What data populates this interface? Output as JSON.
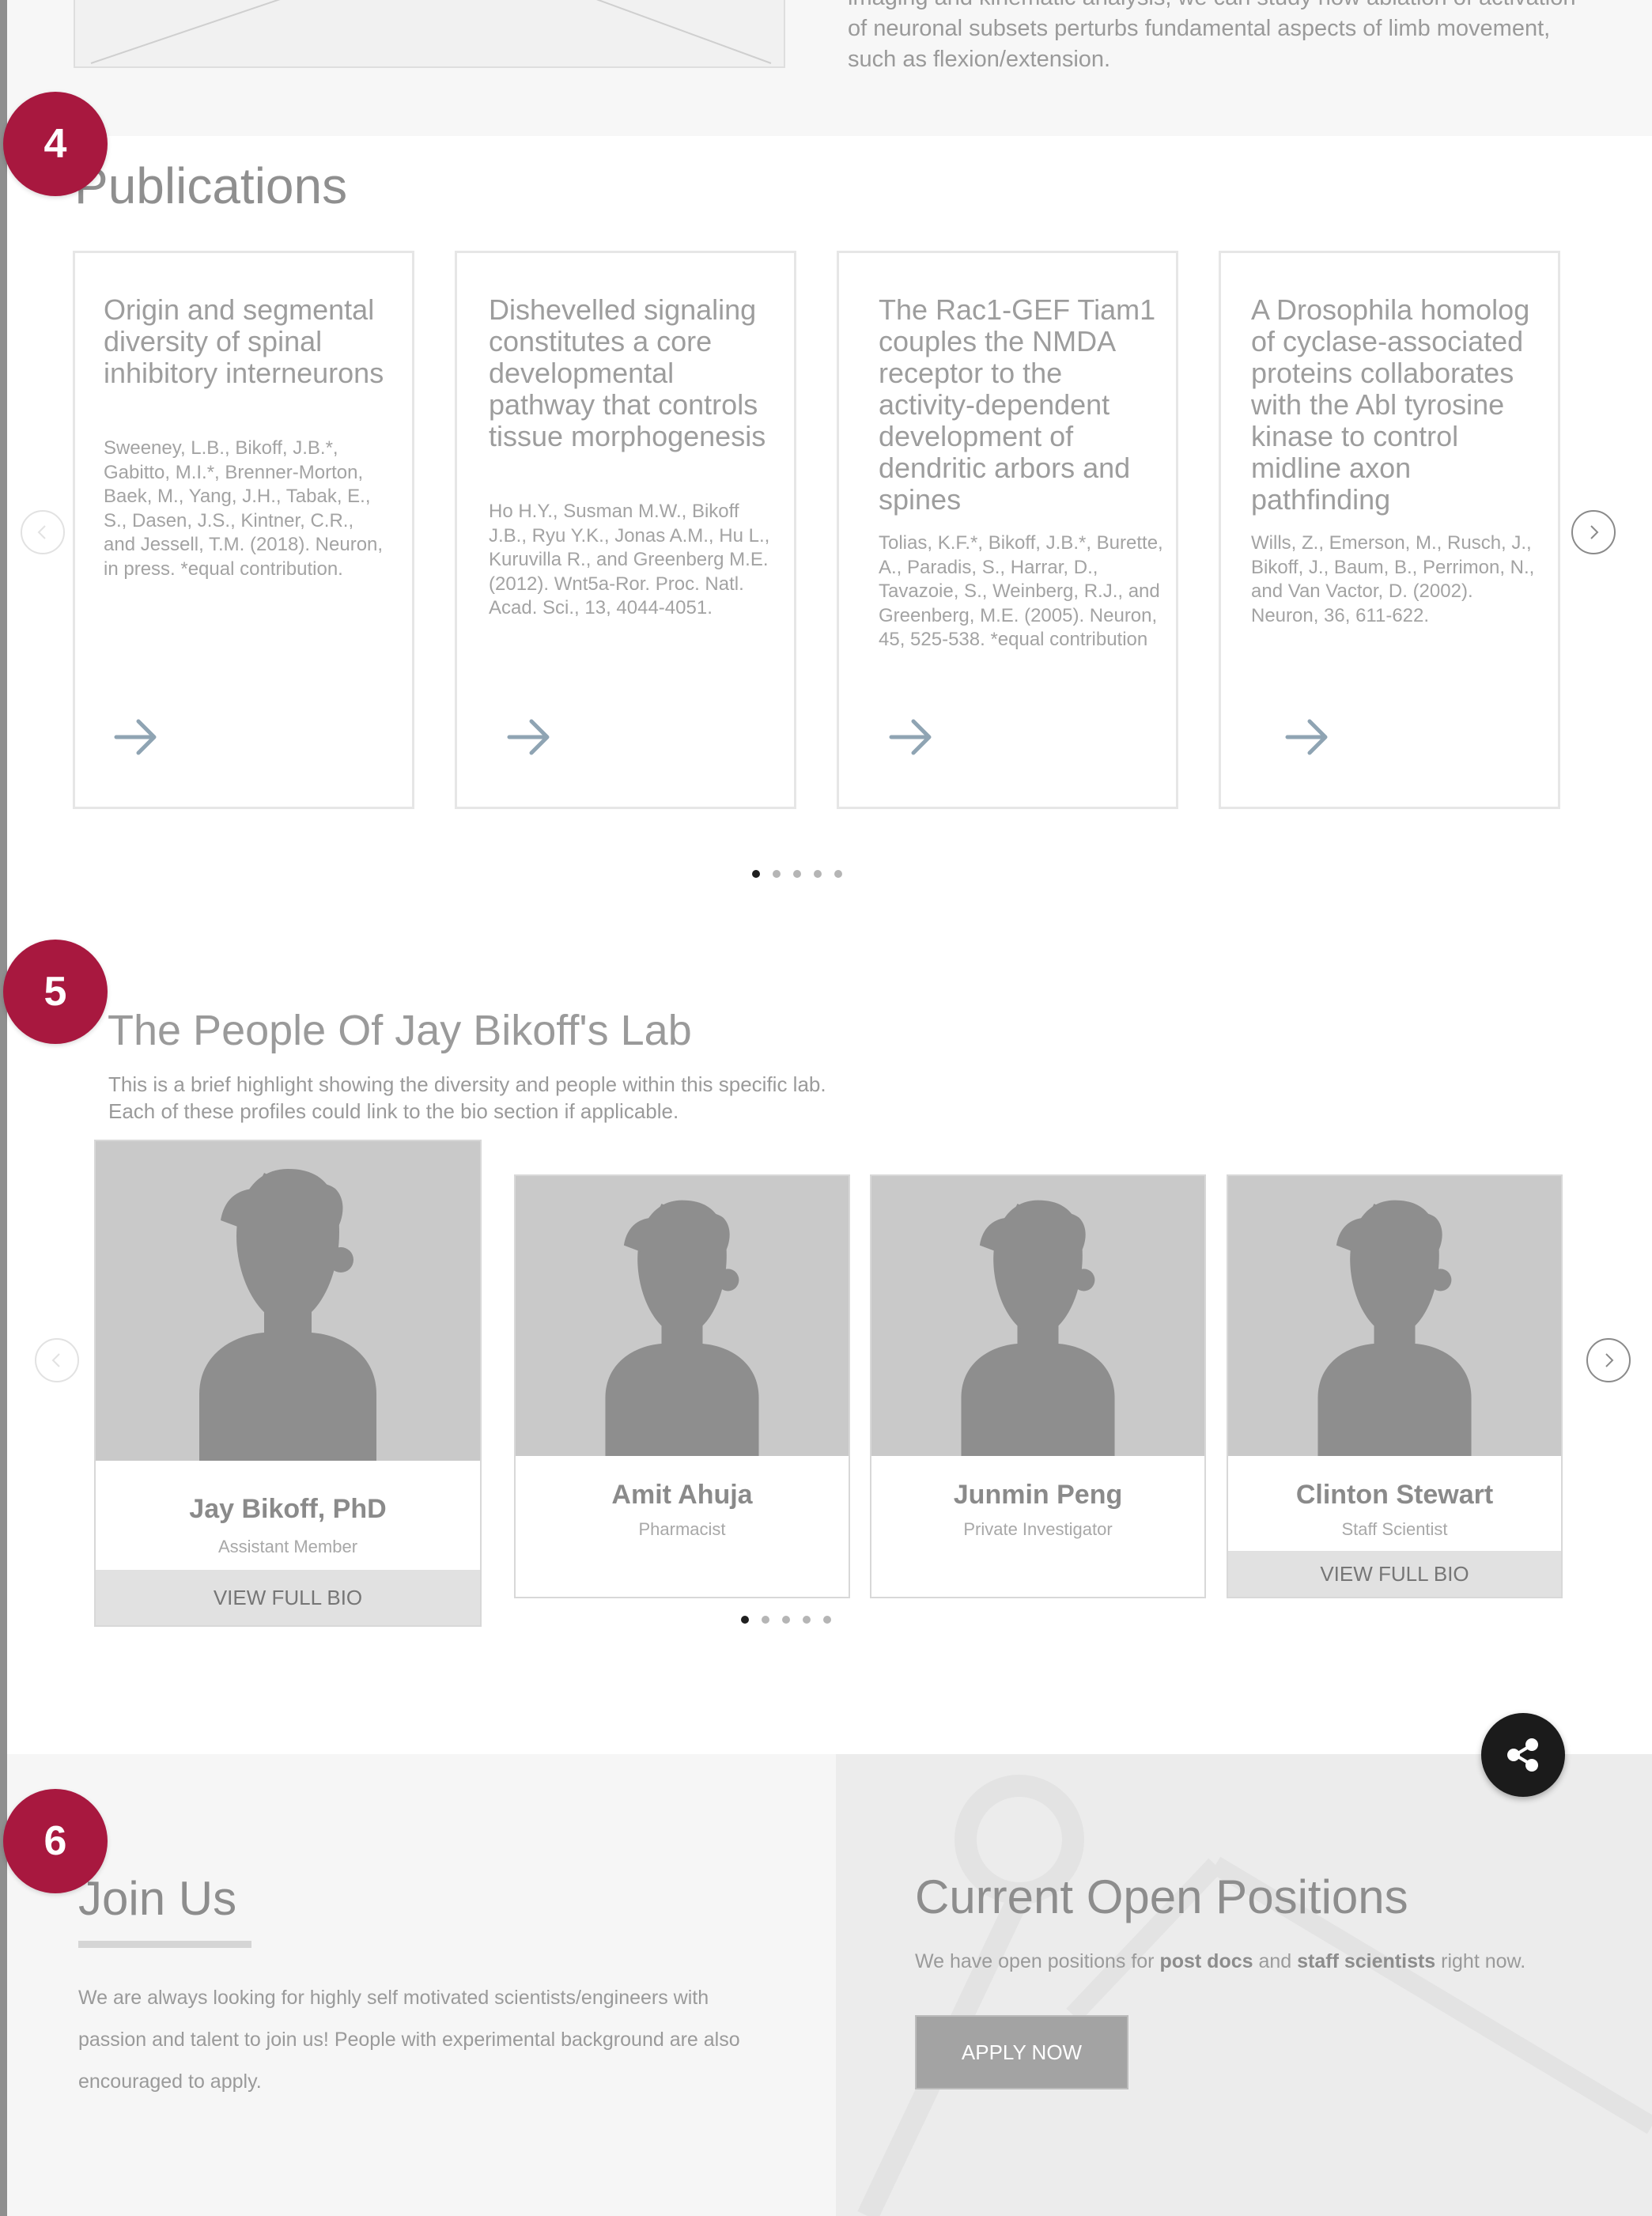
{
  "intro": {
    "text": "imaging and kinematic analysis, we can study how ablation of activation of neuronal subsets perturbs fundamental aspects of limb movement, such as flexion/extension."
  },
  "badges": {
    "step4": "4",
    "step5": "5",
    "step6": "6"
  },
  "publications": {
    "title": "Publications",
    "items": [
      {
        "title": "Origin and segmental diversity of spinal inhibitory interneurons",
        "citation": "Sweeney, L.B., Bikoff, J.B.*, Gabitto, M.I.*, Brenner-Morton, Baek, M., Yang, J.H., Tabak, E., S., Dasen, J.S., Kintner, C.R., and Jessell, T.M. (2018). Neuron, in press. *equal contribution."
      },
      {
        "title": "Dishevelled signaling constitutes a core developmental pathway that controls tissue morphogenesis",
        "citation": "Ho H.Y., Susman M.W., Bikoff J.B., Ryu Y.K., Jonas A.M., Hu L., Kuruvilla R., and Greenberg M.E. (2012). Wnt5a-Ror. Proc. Natl. Acad. Sci., 13, 4044-4051."
      },
      {
        "title": "The Rac1-GEF Tiam1 couples the NMDA receptor to the activity-dependent development of dendritic arbors and spines",
        "citation": "Tolias, K.F.*, Bikoff, J.B.*, Burette, A., Paradis, S., Harrar, D., Tavazoie, S., Weinberg, R.J., and Greenberg, M.E. (2005). Neuron, 45, 525-538. *equal contribution"
      },
      {
        "title": "A Drosophila homolog of cyclase-associated proteins collaborates with the Abl tyrosine kinase to control midline axon pathfinding",
        "citation": "Wills, Z., Emerson, M., Rusch, J., Bikoff, J., Baum, B., Perrimon, N., and Van Vactor, D. (2002). Neuron, 36, 611-622."
      }
    ],
    "active_page": 1,
    "page_count": 5
  },
  "people": {
    "title": "The People Of Jay Bikoff's Lab",
    "description_line1": "This is a brief highlight showing the diversity and people within this specific lab.",
    "description_line2": "Each of these profiles could link to the bio section if applicable.",
    "members": [
      {
        "name": "Jay Bikoff, PhD",
        "role": "Assistant Member",
        "button": "VIEW FULL BIO"
      },
      {
        "name": "Amit Ahuja",
        "role": "Pharmacist"
      },
      {
        "name": "Junmin Peng",
        "role": "Private Investigator"
      },
      {
        "name": "Clinton Stewart",
        "role": "Staff Scientist",
        "button": "VIEW FULL BIO"
      }
    ],
    "active_page": 1,
    "page_count": 5
  },
  "join": {
    "title": "Join Us",
    "text": "We are always looking for highly self motivated scientists/engineers with passion and talent to join us! People with experimental background are also encouraged to apply."
  },
  "positions": {
    "title": "Current Open Positions",
    "text_before": "We have open positions for ",
    "highlight1": "post docs",
    "text_middle": " and ",
    "highlight2": "staff scientists",
    "text_after": " right now.",
    "button": "APPLY NOW"
  },
  "icons": {
    "card_arrow": "arrow-right-icon",
    "carousel_prev": "chevron-left-icon",
    "carousel_next": "chevron-right-icon",
    "share": "share-icon",
    "avatar": "person-placeholder-icon"
  },
  "colors": {
    "badge": "#a8183f",
    "arrow": "#8fa4b3",
    "placeholder_bg": "#c9c9c9",
    "placeholder_figure": "#8e8e8e",
    "share_bg": "#1b1b1b"
  }
}
